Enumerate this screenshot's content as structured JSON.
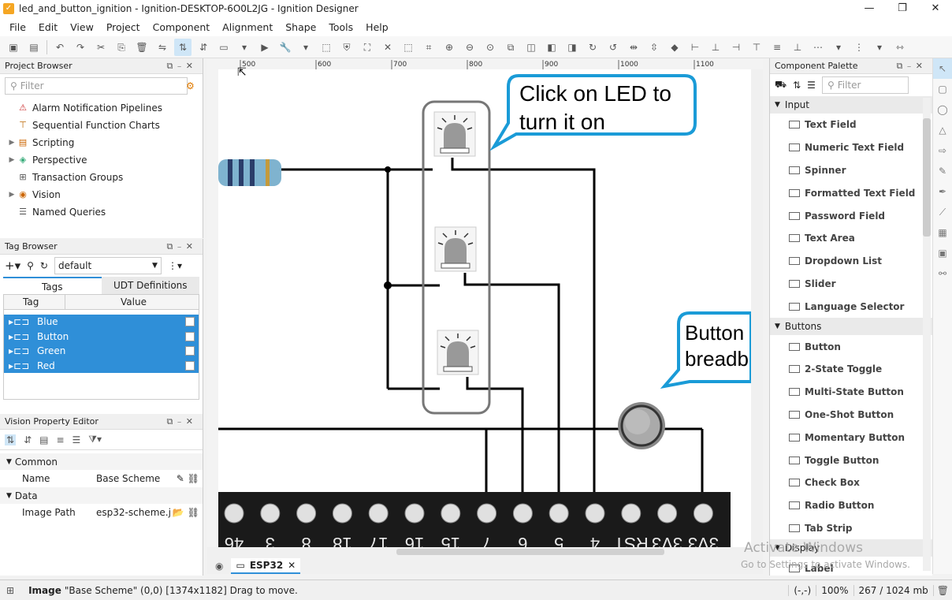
{
  "window": {
    "title": "led_and_button_ignition - Ignition-DESKTOP-6O0L2JG - Ignition Designer",
    "minimize": "—",
    "restore": "❐",
    "close": "✕"
  },
  "menu": [
    "File",
    "Edit",
    "View",
    "Project",
    "Component",
    "Alignment",
    "Shape",
    "Tools",
    "Help"
  ],
  "project_browser": {
    "title": "Project Browser",
    "filter_placeholder": "Filter",
    "items": [
      {
        "label": "Alarm Notification Pipelines",
        "icon": "pipeline-icon",
        "expandable": false
      },
      {
        "label": "Sequential Function Charts",
        "icon": "sfc-icon",
        "expandable": false
      },
      {
        "label": "Scripting",
        "icon": "scripting-icon",
        "expandable": true
      },
      {
        "label": "Perspective",
        "icon": "perspective-icon",
        "expandable": true
      },
      {
        "label": "Transaction Groups",
        "icon": "transaction-icon",
        "expandable": false
      },
      {
        "label": "Vision",
        "icon": "vision-icon",
        "expandable": true
      },
      {
        "label": "Named Queries",
        "icon": "queries-icon",
        "expandable": false
      }
    ]
  },
  "tag_browser": {
    "title": "Tag Browser",
    "provider": "default",
    "tabs": [
      "Tags",
      "UDT Definitions"
    ],
    "columns": [
      "Tag",
      "Value"
    ],
    "tags": [
      "Blue",
      "Button",
      "Green",
      "Red"
    ]
  },
  "property_editor": {
    "title": "Vision Property Editor",
    "sections": [
      {
        "name": "Common",
        "rows": [
          {
            "key": "Name",
            "value": "Base Scheme"
          }
        ]
      },
      {
        "name": "Data",
        "rows": [
          {
            "key": "Image Path",
            "value": "esp32-scheme.j"
          }
        ]
      }
    ]
  },
  "canvas": {
    "callout1": [
      "Click on LED to",
      "turn it on"
    ],
    "callout2": [
      "Button",
      "breadb"
    ],
    "ruler_ticks": [
      "500",
      "600",
      "700",
      "800",
      "900",
      "1000",
      "1100"
    ],
    "pin_labels": [
      "46",
      "3",
      "8",
      "18",
      "17",
      "16",
      "15",
      "7",
      "6",
      "5",
      "4",
      "RST",
      "3V3",
      "3V3"
    ],
    "tab_label": "ESP32"
  },
  "palette": {
    "title": "Component Palette",
    "filter_placeholder": "Filter",
    "categories": [
      {
        "name": "Input",
        "items": [
          "Text Field",
          "Numeric Text Field",
          "Spinner",
          "Formatted Text Field",
          "Password Field",
          "Text Area",
          "Dropdown List",
          "Slider",
          "Language Selector"
        ]
      },
      {
        "name": "Buttons",
        "items": [
          "Button",
          "2-State Toggle",
          "Multi-State Button",
          "One-Shot Button",
          "Momentary Button",
          "Toggle Button",
          "Check Box",
          "Radio Button",
          "Tab Strip"
        ]
      },
      {
        "name": "Display",
        "items": [
          "Label"
        ]
      }
    ]
  },
  "status": {
    "component_type": "Image",
    "description": "\"Base  Scheme\" (0,0) [1374x1182] Drag to move.",
    "coords": "(-,-)",
    "zoom": "100%",
    "memory": "267 / 1024 mb"
  },
  "watermark": {
    "line1": "Activate Windows",
    "line2": "Go to Settings to activate Windows."
  },
  "colors": {
    "accent": "#2f8fd8",
    "callout_border": "#1a9bd7",
    "selection": "#2f8fd8"
  }
}
